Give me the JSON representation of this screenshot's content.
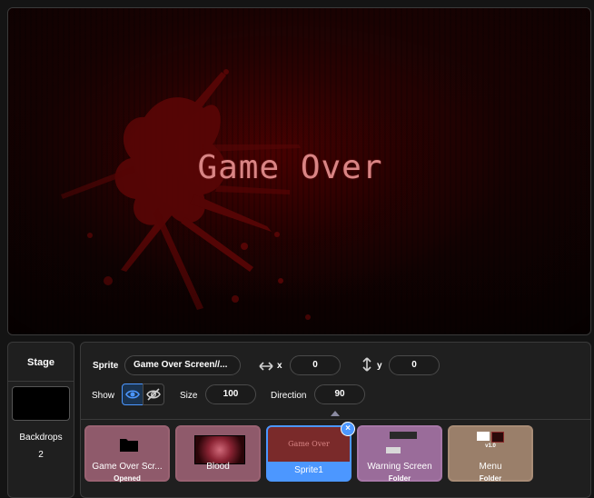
{
  "stage": {
    "game_over_text": "Game Over"
  },
  "stage_panel": {
    "title": "Stage",
    "backdrops_label": "Backdrops",
    "backdrops_count": "2"
  },
  "sprite_info": {
    "sprite_label": "Sprite",
    "sprite_name": "Game Over Screen//...",
    "x_label": "x",
    "x_value": "0",
    "y_label": "y",
    "y_value": "0",
    "show_label": "Show",
    "size_label": "Size",
    "size_value": "100",
    "direction_label": "Direction",
    "direction_value": "90"
  },
  "sprites": [
    {
      "name": "Game Over Scr...",
      "sub": "Opened",
      "kind": "folder",
      "color": "#8f5a6b"
    },
    {
      "name": "Blood",
      "sub": "",
      "kind": "sprite",
      "color": "#8f5a6b"
    },
    {
      "name": "Sprite1",
      "sub": "",
      "kind": "sprite",
      "selected": true,
      "thumb_text": "Game Over",
      "color": "#4c97ff"
    },
    {
      "name": "Warning Screen",
      "sub": "Folder",
      "kind": "folder",
      "color": "#9a6c9a"
    },
    {
      "name": "Menu",
      "sub": "Folder",
      "kind": "folder",
      "thumb_text": "v1.0",
      "color": "#9a7f6a"
    }
  ],
  "icons": {
    "delete": "×"
  },
  "colors": {
    "accent": "#4c97ff",
    "game_over_text": "#d98585"
  }
}
